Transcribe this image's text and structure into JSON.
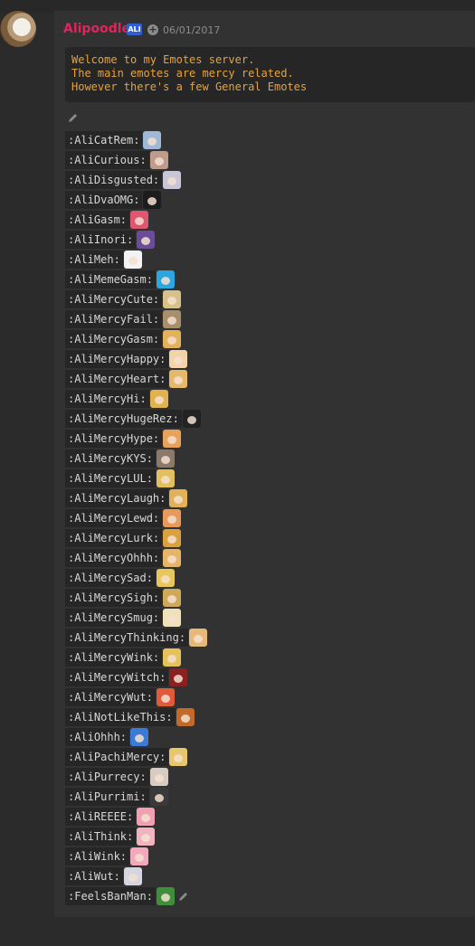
{
  "message": {
    "author": "Alipoodle",
    "tag": "ALI",
    "timestamp": "06/01/2017",
    "code_lines": [
      "Welcome to my Emotes server.",
      "The main emotes are mercy related.",
      "However there's a few General Emotes"
    ]
  },
  "colors": {
    "author": "#e0245e",
    "code_text": "#e6a23c",
    "tag_bg": "#2f5fd0"
  },
  "icons": {
    "edit": "pencil-icon",
    "user_plus": "plus-circle-icon"
  },
  "emotes": [
    {
      "code": ":AliCatRem:",
      "color": "#9fb8d6"
    },
    {
      "code": ":AliCurious:",
      "color": "#c09a8d"
    },
    {
      "code": ":AliDisgusted:",
      "color": "#c7c7d8"
    },
    {
      "code": ":AliDvaOMG:",
      "color": "#1c1c1c"
    },
    {
      "code": ":AliGasm:",
      "color": "#e05570"
    },
    {
      "code": ":AliInori:",
      "color": "#6a4c9a"
    },
    {
      "code": ":AliMeh:",
      "color": "#f3f3f3"
    },
    {
      "code": ":AliMemeGasm:",
      "color": "#2aa7e0"
    },
    {
      "code": ":AliMercyCute:",
      "color": "#d7c18a"
    },
    {
      "code": ":AliMercyFail:",
      "color": "#a68f6a"
    },
    {
      "code": ":AliMercyGasm:",
      "color": "#e3b25a"
    },
    {
      "code": ":AliMercyHappy:",
      "color": "#f2d4a8"
    },
    {
      "code": ":AliMercyHeart:",
      "color": "#e6b86b"
    },
    {
      "code": ":AliMercyHi:",
      "color": "#e2b24f"
    },
    {
      "code": ":AliMercyHugeRez:",
      "color": "#222222"
    },
    {
      "code": ":AliMercyHype:",
      "color": "#e8a25a"
    },
    {
      "code": ":AliMercyKYS:",
      "color": "#8b7a6a"
    },
    {
      "code": ":AliMercyLUL:",
      "color": "#e4bf5d"
    },
    {
      "code": ":AliMercyLaugh:",
      "color": "#e3b05a"
    },
    {
      "code": ":AliMercyLewd:",
      "color": "#e79a5a"
    },
    {
      "code": ":AliMercyLurk:",
      "color": "#d9a23f"
    },
    {
      "code": ":AliMercyOhhh:",
      "color": "#e6b56a"
    },
    {
      "code": ":AliMercySad:",
      "color": "#e8c65b"
    },
    {
      "code": ":AliMercySigh:",
      "color": "#cfa95a"
    },
    {
      "code": ":AliMercySmug:",
      "color": "#f0e2b8"
    },
    {
      "code": ":AliMercyThinking:",
      "color": "#e6b87a"
    },
    {
      "code": ":AliMercyWink:",
      "color": "#e7c25a"
    },
    {
      "code": ":AliMercyWitch:",
      "color": "#8a2020"
    },
    {
      "code": ":AliMercyWut:",
      "color": "#e05a3a"
    },
    {
      "code": ":AliNotLikeThis:",
      "color": "#c26a2a"
    },
    {
      "code": ":AliOhhh:",
      "color": "#3a7ad8"
    },
    {
      "code": ":AliPachiMercy:",
      "color": "#e8c66b"
    },
    {
      "code": ":AliPurrecy:",
      "color": "#d8ccc0"
    },
    {
      "code": ":AliPurrimi:",
      "color": "#3a3a3a"
    },
    {
      "code": ":AliREEEE:",
      "color": "#f0a0b0"
    },
    {
      "code": ":AliThink:",
      "color": "#f2b3c0"
    },
    {
      "code": ":AliWink:",
      "color": "#f3a8bb"
    },
    {
      "code": ":AliWut:",
      "color": "#d6d6e0"
    },
    {
      "code": ":FeelsBanMan:",
      "color": "#3f8f3a"
    }
  ]
}
